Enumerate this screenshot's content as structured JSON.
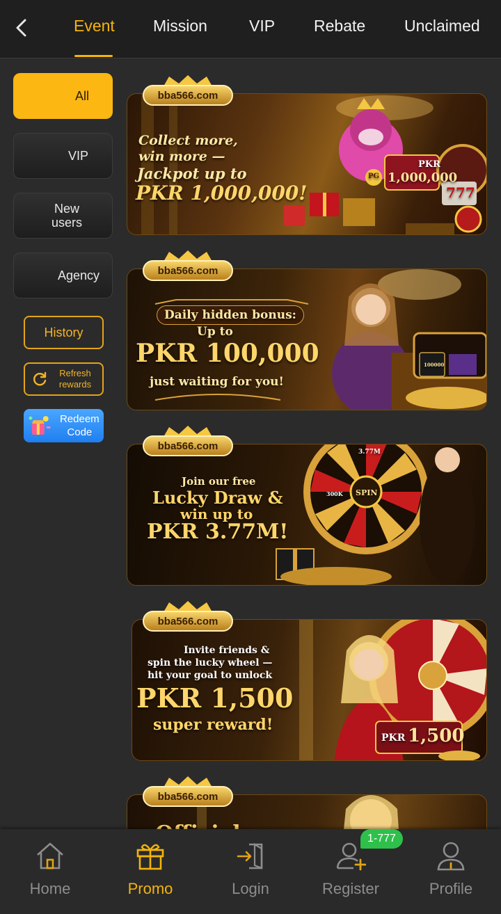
{
  "tabs": [
    {
      "label": "Event"
    },
    {
      "label": "Mission"
    },
    {
      "label": "VIP"
    },
    {
      "label": "Rebate"
    },
    {
      "label": "Unclaimed"
    }
  ],
  "sidebar": {
    "categories": [
      {
        "label": "All"
      },
      {
        "label": "VIP"
      },
      {
        "label": "New users"
      },
      {
        "label": "Agency"
      }
    ],
    "history_label": "History",
    "refresh_label": "Refresh rewards",
    "redeem_label": "Redeem Code"
  },
  "banners": [
    {
      "logo": "bba566.com",
      "line1": "Collect more,",
      "line2": "win more —",
      "line3": "Jackpot up to",
      "line4": "PKR 1,000,000!",
      "tag_top": "PKR",
      "tag_amount": "1,000,000",
      "chip": "PG",
      "slot": "777"
    },
    {
      "logo": "bba566.com",
      "line1": "Daily hidden bonus:",
      "line2": "Up to",
      "line3": "PKR 100,000",
      "line4": "just waiting for you!",
      "card": "100000"
    },
    {
      "logo": "bba566.com",
      "line1": "Join our free",
      "line2": "Lucky Draw &",
      "line3": "win up to",
      "line4": "PKR 3.77M!",
      "wheel_center": "SPIN",
      "wheel_top": "3.77M",
      "wheel_seg": "300K"
    },
    {
      "logo": "bba566.com",
      "line1": "Invite friends &",
      "line2": "spin the lucky wheel —",
      "line3": "hit your goal to unlock",
      "line4": "PKR 1,500",
      "line5": "super reward!",
      "tag_prefix": "PKR",
      "tag_amount": "1,500"
    },
    {
      "logo": "bba566.com",
      "line1": "Official"
    }
  ],
  "bottom_nav": [
    {
      "label": "Home"
    },
    {
      "label": "Promo"
    },
    {
      "label": "Login"
    },
    {
      "label": "Register"
    },
    {
      "label": "Profile"
    }
  ],
  "register_badge": "1-777",
  "colors": {
    "accent": "#f5b40d",
    "background": "#2b2b2b",
    "badge": "#2ec04a"
  }
}
